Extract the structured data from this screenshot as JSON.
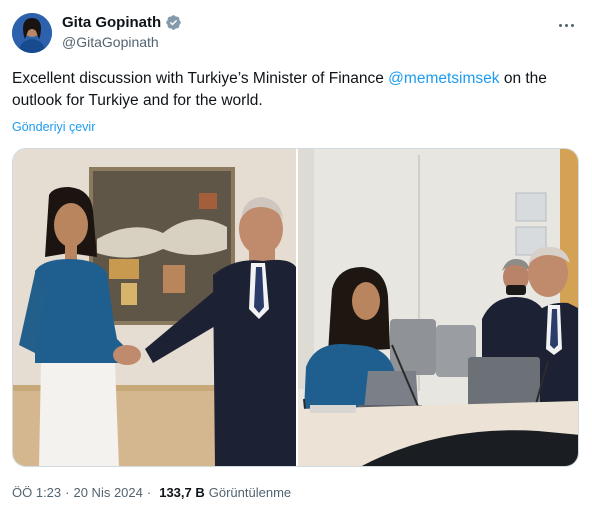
{
  "author": {
    "display_name": "Gita Gopinath",
    "handle": "@GitaGopinath",
    "verified": true
  },
  "tweet": {
    "text_before": "Excellent discussion with Turkiye’s Minister of Finance ",
    "mention": "@memetsimsek",
    "text_after": " on the outlook for Turkiye and for the world.",
    "translate_label": "Gönderiyi çevir"
  },
  "meta": {
    "time": "ÖÖ 1:23",
    "separator": "·",
    "date": "20 Nis 2024",
    "views_count": "133,7 B",
    "views_label": "Görüntülenme"
  },
  "colors": {
    "link": "#1d9bf0",
    "verified_badge": "#829aab",
    "secondary_text": "#536471"
  }
}
